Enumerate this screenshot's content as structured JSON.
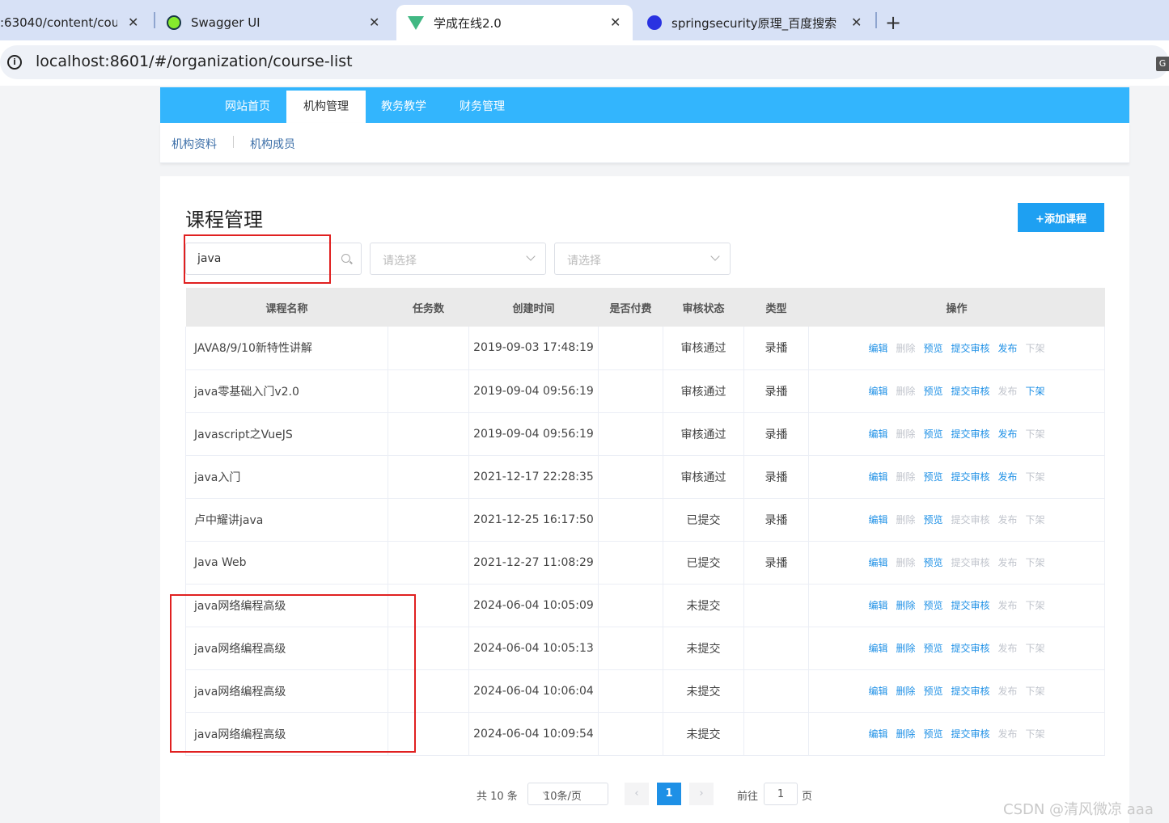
{
  "browser": {
    "tabs": [
      {
        "title": ":63040/content/cou",
        "icon": "page-icon",
        "color": "#d7e1f6"
      },
      {
        "title": "Swagger UI",
        "icon": "swagger-icon",
        "color": "#85ea2d"
      },
      {
        "title": "学成在线2.0",
        "icon": "vue-icon",
        "color": "#41b883"
      },
      {
        "title": "springsecurity原理_百度搜索",
        "icon": "baidu-icon",
        "color": "#2932e1"
      }
    ],
    "close_glyph": "✕",
    "new_tab_glyph": "+",
    "url": "localhost:8601/#/organization/course-list",
    "info_glyph": "i",
    "translate_glyph": "G"
  },
  "nav": {
    "items": [
      "网站首页",
      "机构管理",
      "教务教学",
      "财务管理"
    ],
    "active": "机构管理",
    "sub_items": [
      "机构资料",
      "机构成员"
    ]
  },
  "course_panel": {
    "title": "课程管理",
    "add_button": "+添加课程",
    "search_value": "java",
    "select1_placeholder": "请选择",
    "select2_placeholder": "请选择"
  },
  "table": {
    "headers": [
      "课程名称",
      "任务数",
      "创建时间",
      "是否付费",
      "审核状态",
      "类型",
      "操作"
    ],
    "ops": [
      "编辑",
      "删除",
      "预览",
      "提交审核",
      "发布",
      "下架"
    ],
    "rows": [
      {
        "name": "JAVA8/9/10新特性讲解",
        "tasks": "",
        "created": "2019-09-03 17:48:19",
        "paid": "",
        "status": "审核通过",
        "type": "录播",
        "enabled": [
          true,
          false,
          true,
          true,
          true,
          false
        ]
      },
      {
        "name": "java零基础入门v2.0",
        "tasks": "",
        "created": "2019-09-04 09:56:19",
        "paid": "",
        "status": "审核通过",
        "type": "录播",
        "enabled": [
          true,
          false,
          true,
          true,
          false,
          true
        ]
      },
      {
        "name": "Javascript之VueJS",
        "tasks": "",
        "created": "2019-09-04 09:56:19",
        "paid": "",
        "status": "审核通过",
        "type": "录播",
        "enabled": [
          true,
          false,
          true,
          true,
          true,
          false
        ]
      },
      {
        "name": "java入门",
        "tasks": "",
        "created": "2021-12-17 22:28:35",
        "paid": "",
        "status": "审核通过",
        "type": "录播",
        "enabled": [
          true,
          false,
          true,
          true,
          true,
          false
        ]
      },
      {
        "name": "卢中耀讲java",
        "tasks": "",
        "created": "2021-12-25 16:17:50",
        "paid": "",
        "status": "已提交",
        "type": "录播",
        "enabled": [
          true,
          false,
          true,
          false,
          false,
          false
        ]
      },
      {
        "name": "Java Web",
        "tasks": "",
        "created": "2021-12-27 11:08:29",
        "paid": "",
        "status": "已提交",
        "type": "录播",
        "enabled": [
          true,
          false,
          true,
          false,
          false,
          false
        ]
      },
      {
        "name": "java网络编程高级",
        "tasks": "",
        "created": "2024-06-04 10:05:09",
        "paid": "",
        "status": "未提交",
        "type": "",
        "enabled": [
          true,
          true,
          true,
          true,
          false,
          false
        ]
      },
      {
        "name": "java网络编程高级",
        "tasks": "",
        "created": "2024-06-04 10:05:13",
        "paid": "",
        "status": "未提交",
        "type": "",
        "enabled": [
          true,
          true,
          true,
          true,
          false,
          false
        ]
      },
      {
        "name": "java网络编程高级",
        "tasks": "",
        "created": "2024-06-04 10:06:04",
        "paid": "",
        "status": "未提交",
        "type": "",
        "enabled": [
          true,
          true,
          true,
          true,
          false,
          false
        ]
      },
      {
        "name": "java网络编程高级",
        "tasks": "",
        "created": "2024-06-04 10:09:54",
        "paid": "",
        "status": "未提交",
        "type": "",
        "enabled": [
          true,
          true,
          true,
          true,
          false,
          false
        ]
      }
    ]
  },
  "pagination": {
    "total": "共 10 条",
    "page_size": "10条/页",
    "prev_glyph": "‹",
    "next_glyph": "›",
    "current_page": "1",
    "goto_label": "前往",
    "goto_value": "1",
    "goto_suffix": "页"
  },
  "watermark": "CSDN @清风微凉 aaa",
  "colors": {
    "nav": "#33b5fd",
    "primary": "#1e90e6",
    "annotation": "#e02020"
  }
}
